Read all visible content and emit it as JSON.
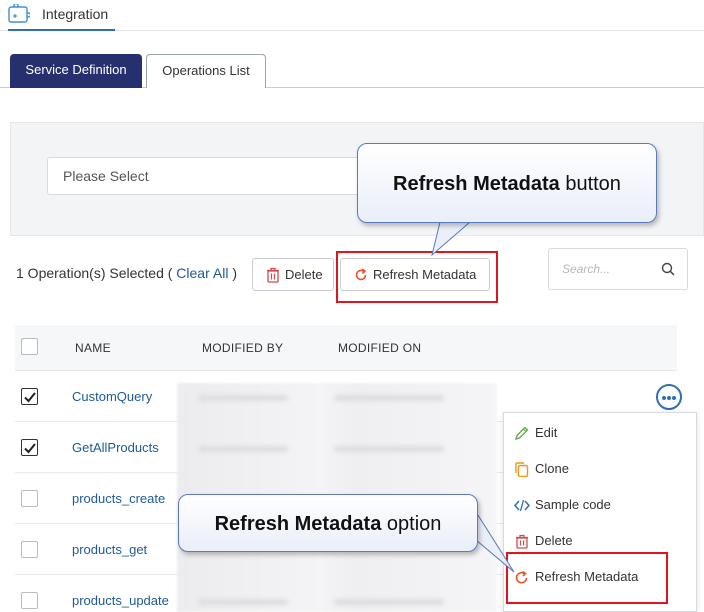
{
  "header": {
    "app_title": "Integration",
    "app_icon": "puzzle-icon",
    "accent": "#2d6fb5"
  },
  "tabs": [
    {
      "label": "Service Definition",
      "active": true
    },
    {
      "label": "Operations List",
      "active": false
    }
  ],
  "filter": {
    "select_value": "Please Select"
  },
  "toolbar": {
    "selected_text": "1 Operation(s) Selected (",
    "clear_all_label": "Clear All",
    "selected_suffix": ")",
    "delete_label": "Delete",
    "refresh_label": "Refresh Metadata",
    "search_placeholder": "Search..."
  },
  "table": {
    "columns": [
      "NAME",
      "MODIFIED BY",
      "MODIFIED ON"
    ],
    "rows": [
      {
        "name": "CustomQuery",
        "checked": true
      },
      {
        "name": "GetAllProducts",
        "checked": true
      },
      {
        "name": "products_create",
        "checked": false
      },
      {
        "name": "products_get",
        "checked": false
      },
      {
        "name": "products_update",
        "checked": false
      }
    ]
  },
  "context_menu": {
    "items": [
      {
        "label": "Edit",
        "icon": "pencil-icon"
      },
      {
        "label": "Clone",
        "icon": "copy-icon"
      },
      {
        "label": "Sample code",
        "icon": "code-icon"
      },
      {
        "label": "Delete",
        "icon": "trash-icon"
      },
      {
        "label": "Refresh Metadata",
        "icon": "refresh-icon"
      }
    ]
  },
  "callouts": {
    "button_bold": "Refresh Metadata",
    "button_rest": " button",
    "option_bold": "Refresh Metadata",
    "option_rest": " option"
  },
  "colors": {
    "tab_active_bg": "#27306e",
    "link": "#1f5a96",
    "highlight": "#e0161e",
    "delete_icon": "#d14a4a",
    "refresh_icon": "#e8562a",
    "edit_icon": "#6aa84f",
    "clone_icon": "#e69a1d",
    "code_icon": "#2d6fb5"
  }
}
